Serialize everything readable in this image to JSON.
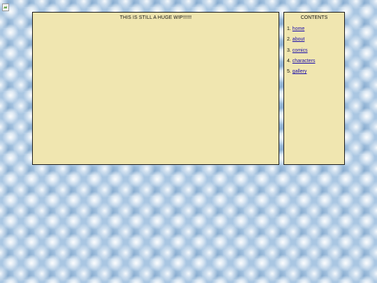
{
  "page": {
    "colors": {
      "panel_background": "#f0e6b0",
      "panel_border": "#1a1a1a",
      "link": "#1a0dab",
      "page_background": "#a9c6e2"
    }
  },
  "main": {
    "title": "THIS IS STILL A HUGE WIP!!!!!!"
  },
  "sidebar": {
    "title": "CONTENTS",
    "items": [
      {
        "number": "1.",
        "label": "home"
      },
      {
        "number": "2.",
        "label": "about"
      },
      {
        "number": "3.",
        "label": "comics"
      },
      {
        "number": "4.",
        "label": "characters"
      },
      {
        "number": "5.",
        "label": "gallery"
      }
    ]
  }
}
